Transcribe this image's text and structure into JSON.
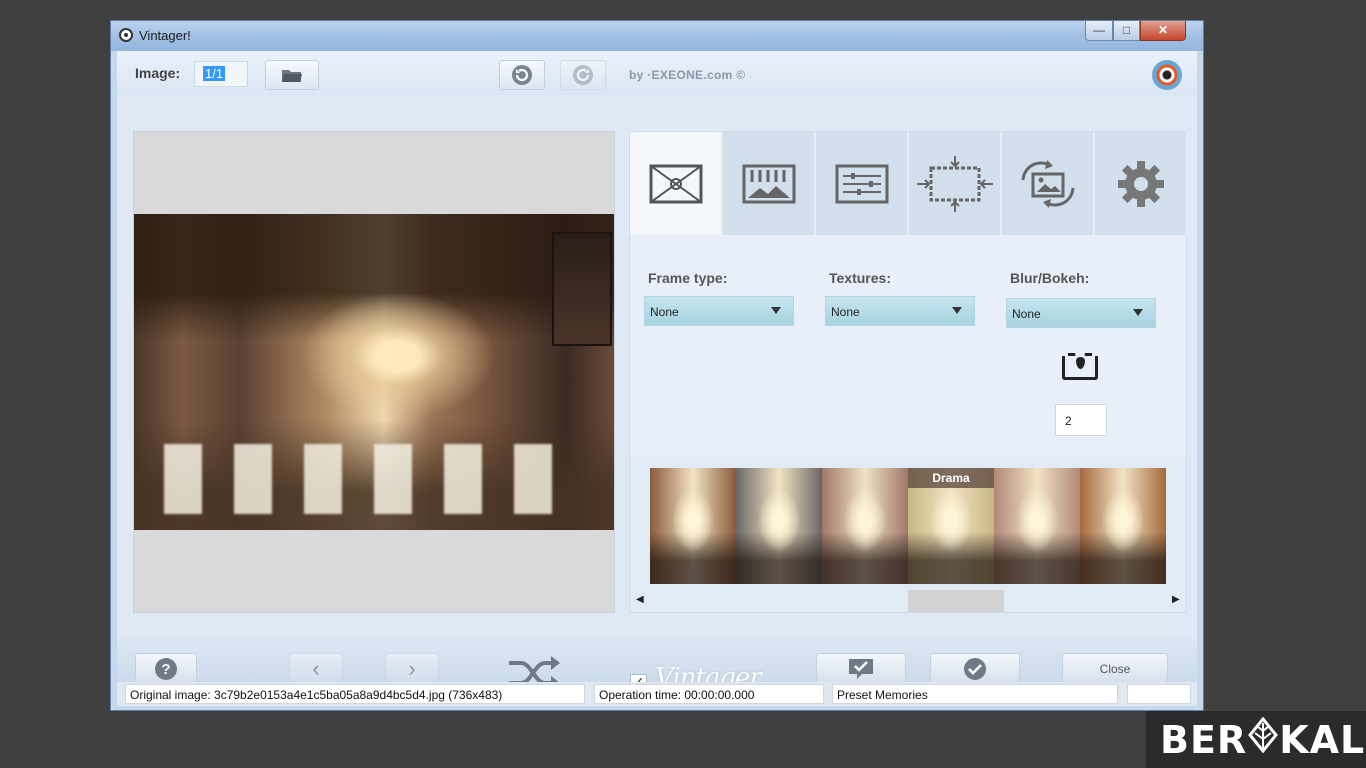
{
  "window": {
    "title": "Vintager!",
    "minimize": "—",
    "maximize": "□",
    "close": "✕"
  },
  "toolbar": {
    "image_label": "Image:",
    "image_value": "1/1",
    "by_text": "by ·EXEONE.com ©",
    "icons": [
      "open-folder-icon",
      "undo-icon",
      "redo-icon",
      "app-logo-icon"
    ]
  },
  "tabs": [
    "frame-tab-icon",
    "textures-tab-icon",
    "adjustments-tab-icon",
    "resize-tab-icon",
    "rotate-tab-icon",
    "settings-gear-icon"
  ],
  "controls": {
    "frame_type": {
      "label": "Frame type:",
      "value": "None"
    },
    "textures": {
      "label": "Textures:",
      "value": "None"
    },
    "blur": {
      "label": "Blur/Bokeh:",
      "value": "None",
      "amount": "2"
    }
  },
  "presets": {
    "visible_label": "Drama",
    "thumbs": [
      {
        "tone": "#8a5a3a"
      },
      {
        "tone": "#6b6766"
      },
      {
        "tone": "#a0786a"
      },
      {
        "tone": "#c9b783"
      },
      {
        "tone": "#b28877"
      },
      {
        "tone": "#a56a3e"
      }
    ]
  },
  "bottom": {
    "help": "?",
    "prev": "‹",
    "next": "›",
    "vintager_checked": "✓",
    "vintager_text": "Vintager",
    "close_label": "Close"
  },
  "status": {
    "original": "Original image: 3c79b2e0153a4e1c5ba05a8a9d4bc5d4.jpg (736x483)",
    "operation_time": "Operation time: 00:00:00.000",
    "preset": "Preset Memories",
    "extra": ""
  },
  "watermark": {
    "left": "BER",
    "right": "KAL"
  },
  "colors": {
    "accent": "#a7d3e2",
    "titlebar": "#a2c0e4",
    "client": "#dfe9f5"
  }
}
